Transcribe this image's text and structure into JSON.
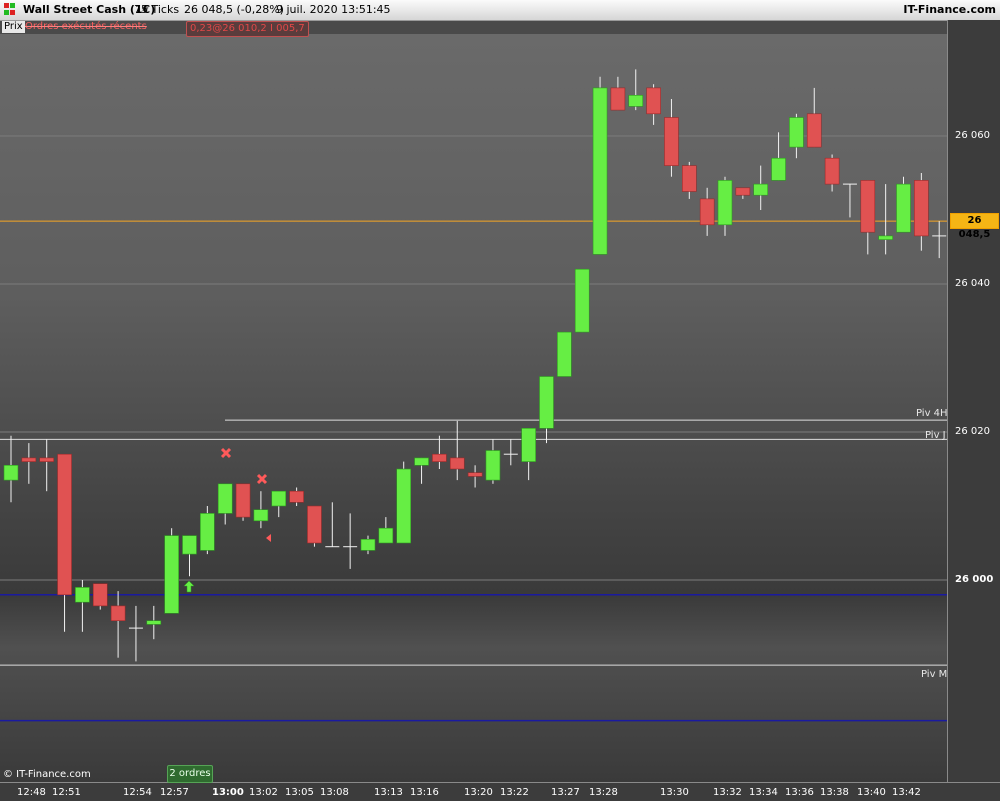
{
  "title_bar": {
    "instrument": "Wall Street Cash (1€)",
    "interval": "75 Ticks",
    "quote": "26 048,5 (-0,28%)",
    "datetime": "9 juil. 2020 13:51:45",
    "brand": "IT-Finance.com"
  },
  "toolbar": {
    "price_tab": "Prix",
    "recent_orders": "Ordres exécutés récents"
  },
  "order_box": "0,23@26 010,2 I 005,7",
  "last_price": "26 048,5",
  "copyright": "© IT-Finance.com",
  "orders_badge": "2 ordres",
  "pivots": [
    {
      "label": "Piv 4H",
      "value": 26021.6
    },
    {
      "label": "Piv J",
      "value": 26019.0
    },
    {
      "label": "Piv M",
      "value": 25988.5
    }
  ],
  "colors": {
    "bull": "#66ee44",
    "bear": "#e05252",
    "last_price_line": "#f5a623",
    "support_line": "#1a1aa0",
    "pivot_line": "#dddddd"
  },
  "chart_data": {
    "type": "candlestick",
    "y_axis_ticks": [
      "26 060",
      "26 040",
      "26 020",
      "26 000"
    ],
    "ylim": [
      25978,
      26074
    ],
    "x_labels": [
      "12:48",
      "12:51",
      "12:54",
      "12:57",
      "13:00",
      "13:02",
      "13:05",
      "13:08",
      "13:13",
      "13:16",
      "13:20",
      "13:22",
      "13:27",
      "13:28",
      "13:30",
      "13:32",
      "13:34",
      "13:36",
      "13:38",
      "13:40",
      "13:42"
    ],
    "bold_x_label": "13:00",
    "horizontal_lines": {
      "last_price": 26048.5,
      "blue_1": 25998.0,
      "blue_2": 25981.0
    },
    "candles": [
      {
        "o": 26013.5,
        "h": 26019.5,
        "l": 26010.5,
        "c": 26015.5
      },
      {
        "o": 26016.5,
        "h": 26018.5,
        "l": 26013.0,
        "c": 26016.0
      },
      {
        "o": 26016.5,
        "h": 26019.0,
        "l": 26012.0,
        "c": 26016.0
      },
      {
        "o": 26017.0,
        "h": 26017.0,
        "l": 25993.0,
        "c": 25998.0
      },
      {
        "o": 25997.0,
        "h": 26000.0,
        "l": 25993.0,
        "c": 25999.0
      },
      {
        "o": 25999.5,
        "h": 25999.5,
        "l": 25996.0,
        "c": 25996.5
      },
      {
        "o": 25996.5,
        "h": 25998.5,
        "l": 25989.5,
        "c": 25994.5
      },
      {
        "o": 25993.5,
        "h": 25996.5,
        "l": 25989.0,
        "c": 25993.5
      },
      {
        "o": 25994.0,
        "h": 25996.5,
        "l": 25992.0,
        "c": 25994.5
      },
      {
        "o": 25995.5,
        "h": 26007.0,
        "l": 25995.5,
        "c": 26006.0
      },
      {
        "o": 26003.5,
        "h": 26006.0,
        "l": 26000.5,
        "c": 26006.0
      },
      {
        "o": 26004.0,
        "h": 26010.0,
        "l": 26003.5,
        "c": 26009.0
      },
      {
        "o": 26009.0,
        "h": 26013.0,
        "l": 26007.5,
        "c": 26013.0
      },
      {
        "o": 26013.0,
        "h": 26013.0,
        "l": 26008.0,
        "c": 26008.5
      },
      {
        "o": 26008.0,
        "h": 26012.0,
        "l": 26007.0,
        "c": 26009.5
      },
      {
        "o": 26010.0,
        "h": 26012.0,
        "l": 26008.5,
        "c": 26012.0
      },
      {
        "o": 26012.0,
        "h": 26012.5,
        "l": 26010.0,
        "c": 26010.5
      },
      {
        "o": 26010.0,
        "h": 26010.0,
        "l": 26004.5,
        "c": 26005.0
      },
      {
        "o": 26004.5,
        "h": 26010.5,
        "l": 26004.5,
        "c": 26004.5
      },
      {
        "o": 26004.5,
        "h": 26009.0,
        "l": 26001.5,
        "c": 26004.5
      },
      {
        "o": 26004.0,
        "h": 26006.0,
        "l": 26003.5,
        "c": 26005.5
      },
      {
        "o": 26005.0,
        "h": 26008.5,
        "l": 26005.0,
        "c": 26007.0
      },
      {
        "o": 26005.0,
        "h": 26016.0,
        "l": 26005.0,
        "c": 26015.0
      },
      {
        "o": 26015.5,
        "h": 26016.5,
        "l": 26013.0,
        "c": 26016.5
      },
      {
        "o": 26017.0,
        "h": 26019.5,
        "l": 26015.0,
        "c": 26016.0
      },
      {
        "o": 26016.5,
        "h": 26021.5,
        "l": 26013.5,
        "c": 26015.0
      },
      {
        "o": 26014.5,
        "h": 26015.5,
        "l": 26012.5,
        "c": 26014.0
      },
      {
        "o": 26013.5,
        "h": 26019.0,
        "l": 26013.0,
        "c": 26017.5
      },
      {
        "o": 26017.0,
        "h": 26019.0,
        "l": 26015.5,
        "c": 26017.0
      },
      {
        "o": 26016.0,
        "h": 26020.5,
        "l": 26013.5,
        "c": 26020.5
      },
      {
        "o": 26020.5,
        "h": 26026.5,
        "l": 26018.5,
        "c": 26027.5
      },
      {
        "o": 26027.5,
        "h": 26033.5,
        "l": 26027.5,
        "c": 26033.5
      },
      {
        "o": 26033.5,
        "h": 26042.0,
        "l": 26033.5,
        "c": 26042.0
      },
      {
        "o": 26044.0,
        "h": 26068.0,
        "l": 26044.0,
        "c": 26066.5
      },
      {
        "o": 26066.5,
        "h": 26068.0,
        "l": 26063.5,
        "c": 26063.5
      },
      {
        "o": 26064.0,
        "h": 26069.0,
        "l": 26063.5,
        "c": 26065.5
      },
      {
        "o": 26066.5,
        "h": 26067.0,
        "l": 26061.5,
        "c": 26063.0
      },
      {
        "o": 26062.5,
        "h": 26065.0,
        "l": 26054.5,
        "c": 26056.0
      },
      {
        "o": 26056.0,
        "h": 26056.5,
        "l": 26051.5,
        "c": 26052.5
      },
      {
        "o": 26051.5,
        "h": 26053.0,
        "l": 26046.5,
        "c": 26048.0
      },
      {
        "o": 26048.0,
        "h": 26054.5,
        "l": 26046.5,
        "c": 26054.0
      },
      {
        "o": 26053.0,
        "h": 26053.0,
        "l": 26051.5,
        "c": 26052.0
      },
      {
        "o": 26052.0,
        "h": 26056.0,
        "l": 26050.0,
        "c": 26053.5
      },
      {
        "o": 26054.0,
        "h": 26060.5,
        "l": 26054.0,
        "c": 26057.0
      },
      {
        "o": 26058.5,
        "h": 26063.0,
        "l": 26057.0,
        "c": 26062.5
      },
      {
        "o": 26063.0,
        "h": 26066.5,
        "l": 26058.5,
        "c": 26058.5
      },
      {
        "o": 26057.0,
        "h": 26057.5,
        "l": 26052.5,
        "c": 26053.5
      },
      {
        "o": 26053.5,
        "h": 26053.5,
        "l": 26049.0,
        "c": 26053.5
      },
      {
        "o": 26054.0,
        "h": 26054.0,
        "l": 26044.0,
        "c": 26047.0
      },
      {
        "o": 26046.0,
        "h": 26053.5,
        "l": 26044.0,
        "c": 26046.5
      },
      {
        "o": 26047.0,
        "h": 26054.5,
        "l": 26047.0,
        "c": 26053.5
      },
      {
        "o": 26054.0,
        "h": 26055.0,
        "l": 26044.5,
        "c": 26046.5
      },
      {
        "o": 26046.5,
        "h": 26048.5,
        "l": 26043.5,
        "c": 26046.5
      }
    ]
  }
}
